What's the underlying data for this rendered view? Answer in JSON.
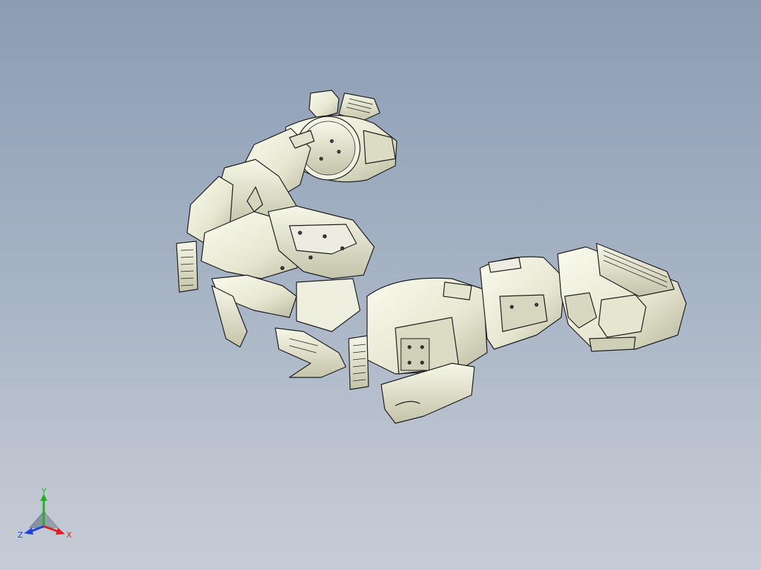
{
  "viewport": {
    "background_top": "#8c9db3",
    "background_bottom": "#c6ccd6"
  },
  "model": {
    "part_fill": "#eeeeda",
    "part_shade": "#c9c9b0",
    "edge_color": "#1a1a1a"
  },
  "triad": {
    "x_label": "X",
    "y_label": "Y",
    "z_label": "Z",
    "x_color": "#e02020",
    "y_color": "#20b020",
    "z_color": "#2040e0"
  }
}
